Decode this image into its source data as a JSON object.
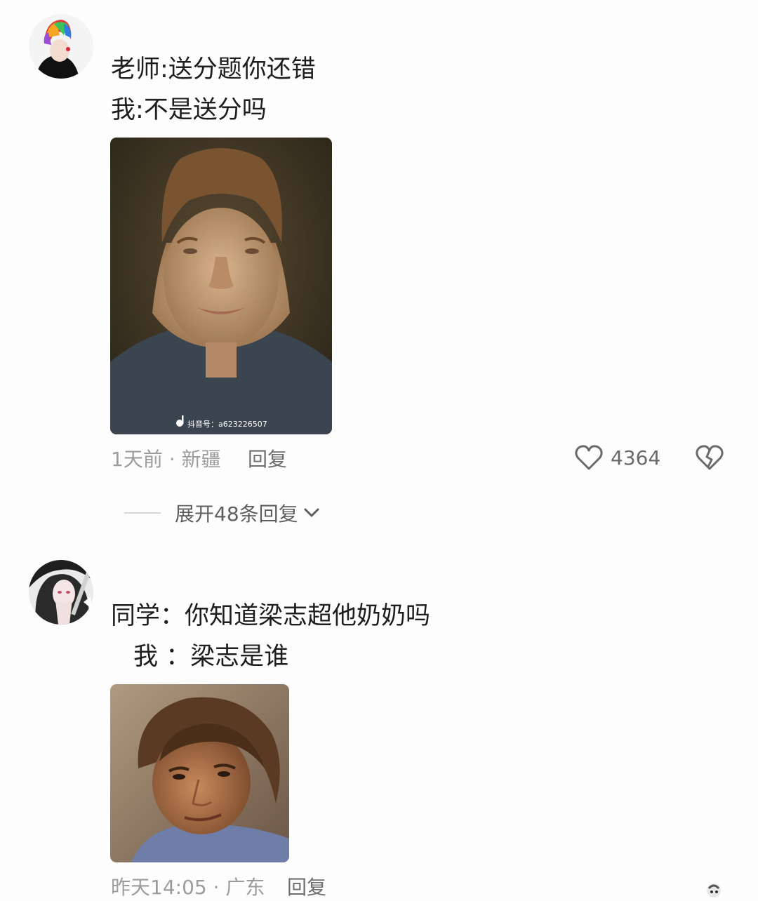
{
  "comments": [
    {
      "line1": "老师:送分题你还错",
      "line2": "我:不是送分吗",
      "watermark": "抖音号：a623226507",
      "meta": "1天前 · 新疆",
      "reply_label": "回复",
      "likes": "4364",
      "expand_label": "展开48条回复"
    },
    {
      "line1": "同学：你知道梁志超他奶奶吗",
      "line2": "我 ：梁志是谁",
      "meta": "昨天14:05 · 广东",
      "reply_label": "回复"
    }
  ],
  "icons": [
    "avatar-rainbow-hair",
    "avatar-anime-girl",
    "heart-icon",
    "broken-heart-icon",
    "chevron-down-icon",
    "tiktok-logo-icon",
    "sticker-icon"
  ],
  "colors": {
    "text": "#1e1e1e",
    "meta": "#9c9c9c",
    "icon": "#6a6a6a"
  }
}
